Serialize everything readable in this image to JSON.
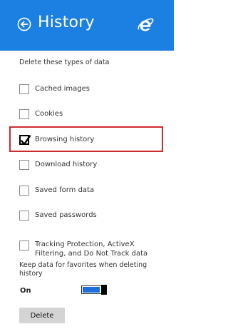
{
  "header": {
    "title": "History",
    "back_icon": "back-arrow-icon",
    "logo_icon": "internet-explorer-logo-icon",
    "background": "#1c80e2"
  },
  "section_label": "Delete these types of data",
  "options": [
    {
      "label": "Cached images",
      "checked": false
    },
    {
      "label": "Cookies",
      "checked": false
    },
    {
      "label": "Browsing history",
      "checked": true
    },
    {
      "label": "Download history",
      "checked": false
    },
    {
      "label": "Saved form data",
      "checked": false
    },
    {
      "label": "Saved passwords",
      "checked": false
    },
    {
      "label": "Tracking Protection, ActiveX Filtering, and Do Not Track data",
      "checked": false
    }
  ],
  "highlight_color": "#cc2b2b",
  "keep_favorites": {
    "label": "Keep data for favorites when deleting history",
    "state": "On"
  },
  "delete_button": "Delete"
}
